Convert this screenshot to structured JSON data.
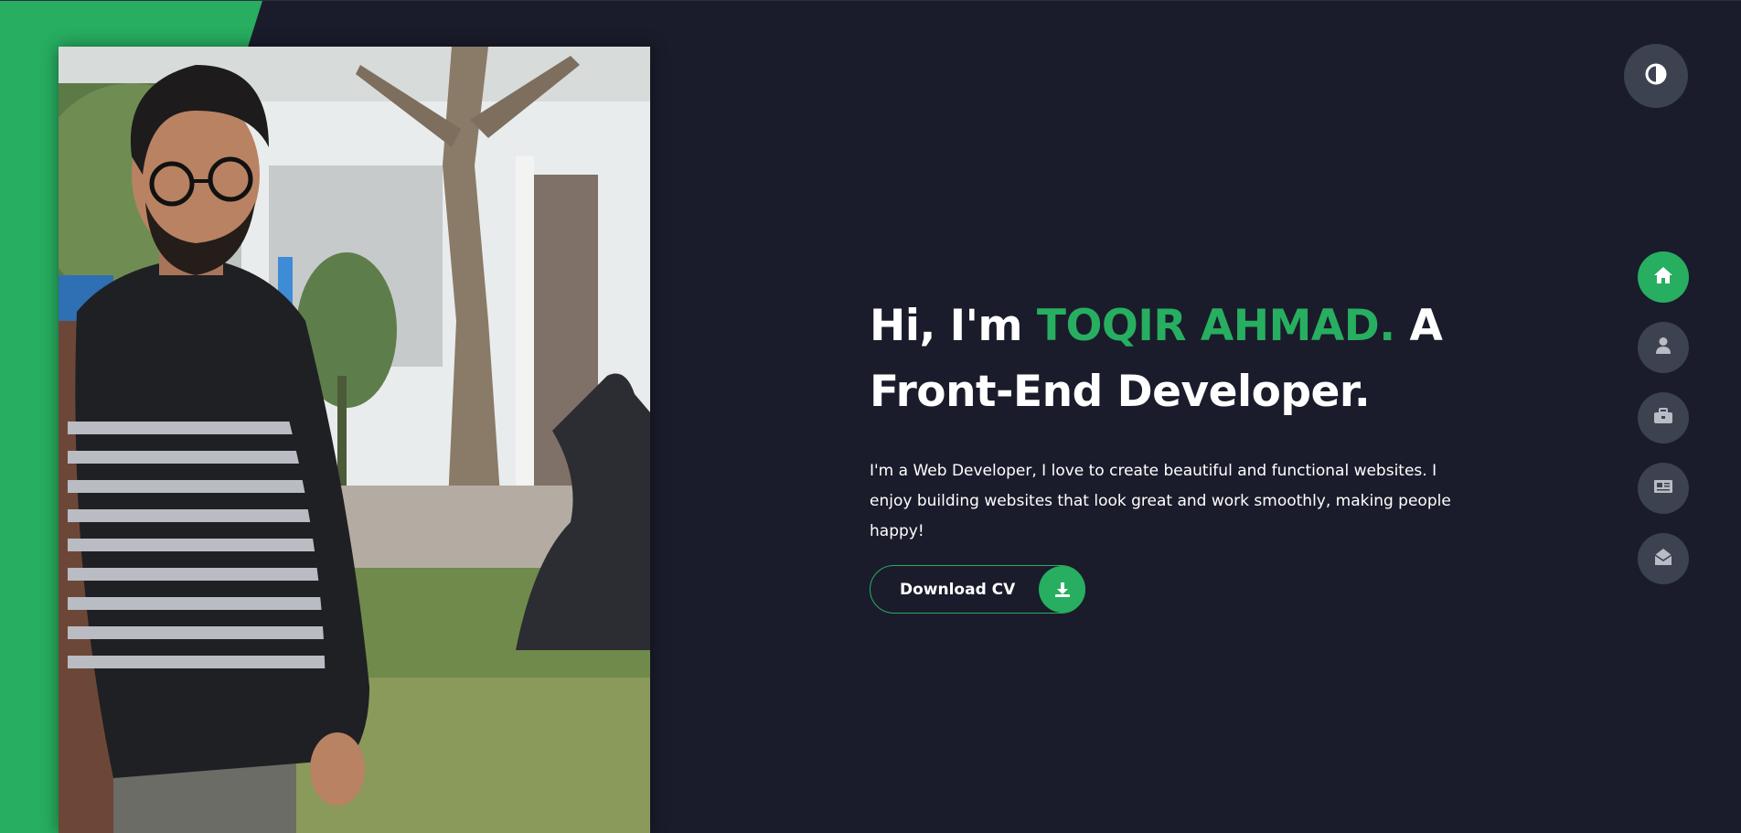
{
  "hero": {
    "greeting": "Hi, I'm ",
    "name": "TOQIR AHMAD.",
    "role_a": " A",
    "role_b": "Front-End Developer.",
    "description": "I'm a Web Developer, I love to create beautiful and functional websites. I enjoy building websites that look great and work smoothly, making people happy!",
    "cv_button_label": "Download CV"
  },
  "theme_toggle": {
    "icon": "contrast-icon"
  },
  "nav": {
    "items": [
      {
        "key": "home",
        "icon": "home-icon",
        "active": true
      },
      {
        "key": "about",
        "icon": "user-icon",
        "active": false
      },
      {
        "key": "portfolio",
        "icon": "briefcase-icon",
        "active": false
      },
      {
        "key": "blog",
        "icon": "newspaper-icon",
        "active": false
      },
      {
        "key": "contact",
        "icon": "envelope-open-icon",
        "active": false
      }
    ]
  },
  "colors": {
    "background": "#1a1c2b",
    "accent": "#27ae60",
    "button_gray": "#3d4250",
    "text": "#ffffff"
  }
}
